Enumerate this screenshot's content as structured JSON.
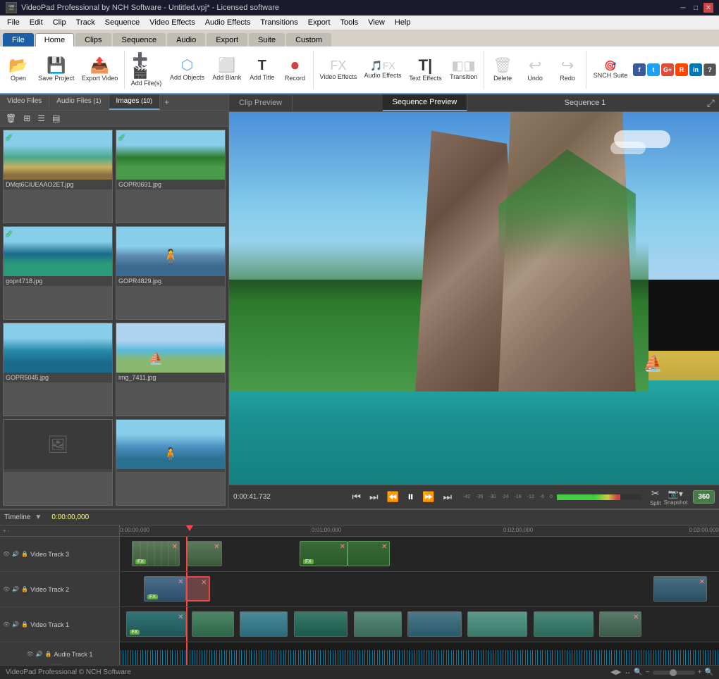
{
  "app": {
    "title": "VideoPad Professional by NCH Software - Untitled.vpj* - Licensed software",
    "logo_icons": [
      "file",
      "save",
      "undo",
      "redo",
      "cut"
    ]
  },
  "titlebar": {
    "title": "VideoPad Professional by NCH Software - Untitled.vpj* - Licensed software",
    "minimize": "─",
    "maximize": "□",
    "close": "✕"
  },
  "menubar": {
    "items": [
      "File",
      "Edit",
      "Clip",
      "Track",
      "Sequence",
      "Video Effects",
      "Audio Effects",
      "Transitions",
      "Export",
      "Tools",
      "View",
      "Help"
    ]
  },
  "ribbon_tabs": {
    "tabs": [
      "File",
      "Home",
      "Clips",
      "Sequence",
      "Audio",
      "Export",
      "Suite",
      "Custom"
    ],
    "active": "Home"
  },
  "toolbar": {
    "buttons": [
      {
        "id": "open",
        "icon": "📂",
        "label": "Open"
      },
      {
        "id": "save-project",
        "icon": "💾",
        "label": "Save Project"
      },
      {
        "id": "export-video",
        "icon": "📤",
        "label": "Export Video"
      },
      {
        "id": "add-files",
        "icon": "➕",
        "label": "Add File(s)"
      },
      {
        "id": "add-objects",
        "icon": "🔷",
        "label": "Add Objects"
      },
      {
        "id": "add-blank",
        "icon": "⬜",
        "label": "Add Blank"
      },
      {
        "id": "add-title",
        "icon": "T",
        "label": "Add Title"
      },
      {
        "id": "record",
        "icon": "⏺",
        "label": "Record"
      },
      {
        "id": "video-effects",
        "icon": "🎬",
        "label": "Video Effects"
      },
      {
        "id": "audio-effects",
        "icon": "🎵",
        "label": "Audio Effects"
      },
      {
        "id": "text-effects",
        "icon": "T",
        "label": "Text Effects"
      },
      {
        "id": "transition",
        "icon": "⬡",
        "label": "Transition"
      },
      {
        "id": "delete",
        "icon": "🗑",
        "label": "Delete"
      },
      {
        "id": "undo",
        "icon": "↩",
        "label": "Undo"
      },
      {
        "id": "redo",
        "icon": "↪",
        "label": "Redo"
      },
      {
        "id": "snch-suite",
        "icon": "🎯",
        "label": "SNCH Suite"
      }
    ]
  },
  "media_panel": {
    "tabs": [
      "Video Files",
      "Audio Files (1)",
      "Images (10)"
    ],
    "active_tab": "Images (10)",
    "items": [
      {
        "name": "DMqt6CiUEAAO2ET.jpg",
        "thumb_type": "beach",
        "checked": true
      },
      {
        "name": "GOPR0691.jpg",
        "thumb_type": "forest",
        "checked": true
      },
      {
        "name": "gopr4718.jpg",
        "thumb_type": "ocean",
        "checked": true
      },
      {
        "name": "GOPR4829.jpg",
        "thumb_type": "person"
      },
      {
        "name": "GOPR5045.jpg",
        "thumb_type": "water"
      },
      {
        "name": "img_7411.jpg",
        "thumb_type": "boat"
      },
      {
        "name": "",
        "thumb_type": "placeholder"
      },
      {
        "name": "",
        "thumb_type": "person2"
      }
    ]
  },
  "preview": {
    "tabs": [
      "Clip Preview",
      "Sequence Preview"
    ],
    "active_tab": "Sequence Preview",
    "sequence_title": "Sequence 1",
    "timestamp": "0:00:41.732",
    "controls": [
      "⏮",
      "⏭",
      "⏪",
      "⏸",
      "⏩",
      "⏭"
    ],
    "split_label": "Split",
    "snapshot_label": "Snapshot",
    "badge_360": "360"
  },
  "timeline": {
    "label": "Timeline",
    "time": "0:00:00,000",
    "ruler_marks": [
      "0:00:00,000",
      "0:01:00,000",
      "0:02:00,000",
      "0:03:00,000"
    ],
    "tracks": [
      {
        "name": "Video Track 3",
        "type": "video"
      },
      {
        "name": "Video Track 2",
        "type": "video"
      },
      {
        "name": "Video Track 1",
        "type": "video"
      },
      {
        "name": "Audio Track 1",
        "type": "audio"
      }
    ]
  },
  "statusbar": {
    "left": "VideoPad Professional © NCH Software",
    "right_icons": [
      "◀▶",
      "↔",
      "🔍",
      "−",
      "●",
      "+",
      "🔍"
    ]
  }
}
